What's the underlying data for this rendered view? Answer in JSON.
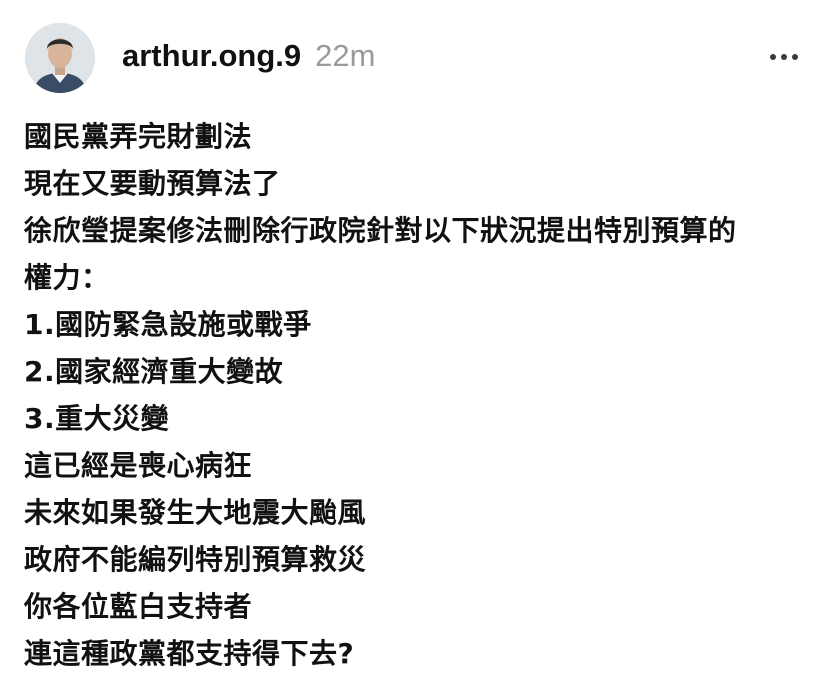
{
  "post": {
    "username": "arthur.ong.9",
    "timestamp": "22m",
    "more_icon": "more-horizontal-icon",
    "avatar_icon": "profile-photo",
    "lines": [
      "國民黨弄完財劃法",
      "現在又要動預算法了",
      "徐欣瑩提案修法刪除行政院針對以下狀況提出特別預算的",
      "權力：",
      "1.國防緊急設施或戰爭",
      "2.國家經濟重大變故",
      "3.重大災變",
      "這已經是喪心病狂",
      "未來如果發生大地震大颱風",
      "政府不能編列特別預算救災",
      "你各位藍白支持者",
      "連這種政黨都支持得下去?"
    ]
  },
  "colors": {
    "text": "#111111",
    "muted": "#9a9a9a",
    "background": "#ffffff"
  }
}
